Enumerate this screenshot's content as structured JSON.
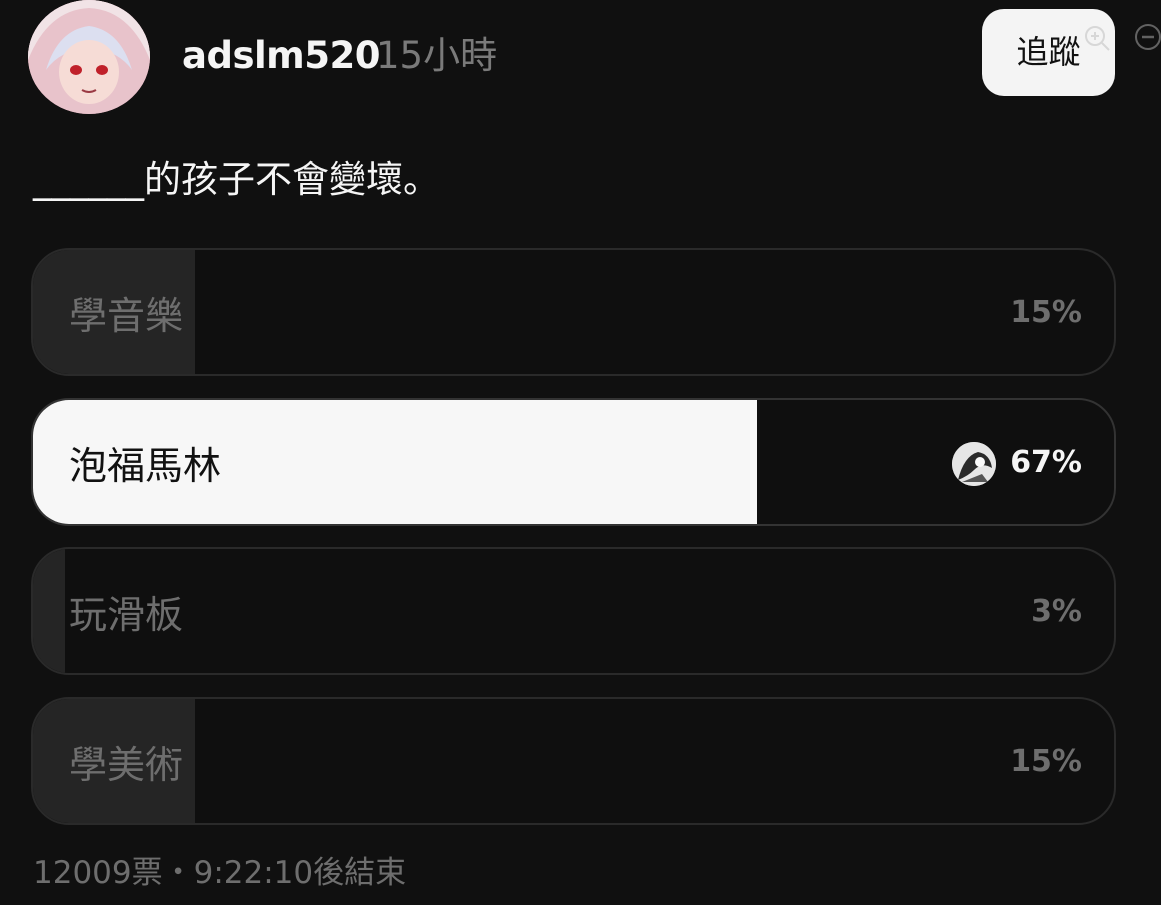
{
  "post": {
    "username": "adslm520",
    "timestamp": "15小時",
    "follow_label": "追蹤",
    "question": "______的孩子不會變壞。"
  },
  "poll": {
    "options": [
      {
        "label": "學音樂",
        "percent": "15%",
        "fraction": 0.15,
        "selected": false
      },
      {
        "label": "泡福馬林",
        "percent": "67%",
        "fraction": 0.67,
        "selected": true
      },
      {
        "label": "玩滑板",
        "percent": "3%",
        "fraction": 0.03,
        "selected": false
      },
      {
        "label": "學美術",
        "percent": "15%",
        "fraction": 0.15,
        "selected": false
      }
    ],
    "footer": "12009票・9:22:10後結束"
  },
  "icons": {
    "profile": "avatar",
    "voter": "voter-avatar-icon",
    "zoom_in": "zoom-in-icon",
    "zoom_out": "zoom-out-icon"
  },
  "colors": {
    "background": "#101010",
    "selected_fill": "#f7f7f7",
    "unselected_fill": "#252525",
    "muted_text": "#6e6e6e"
  }
}
